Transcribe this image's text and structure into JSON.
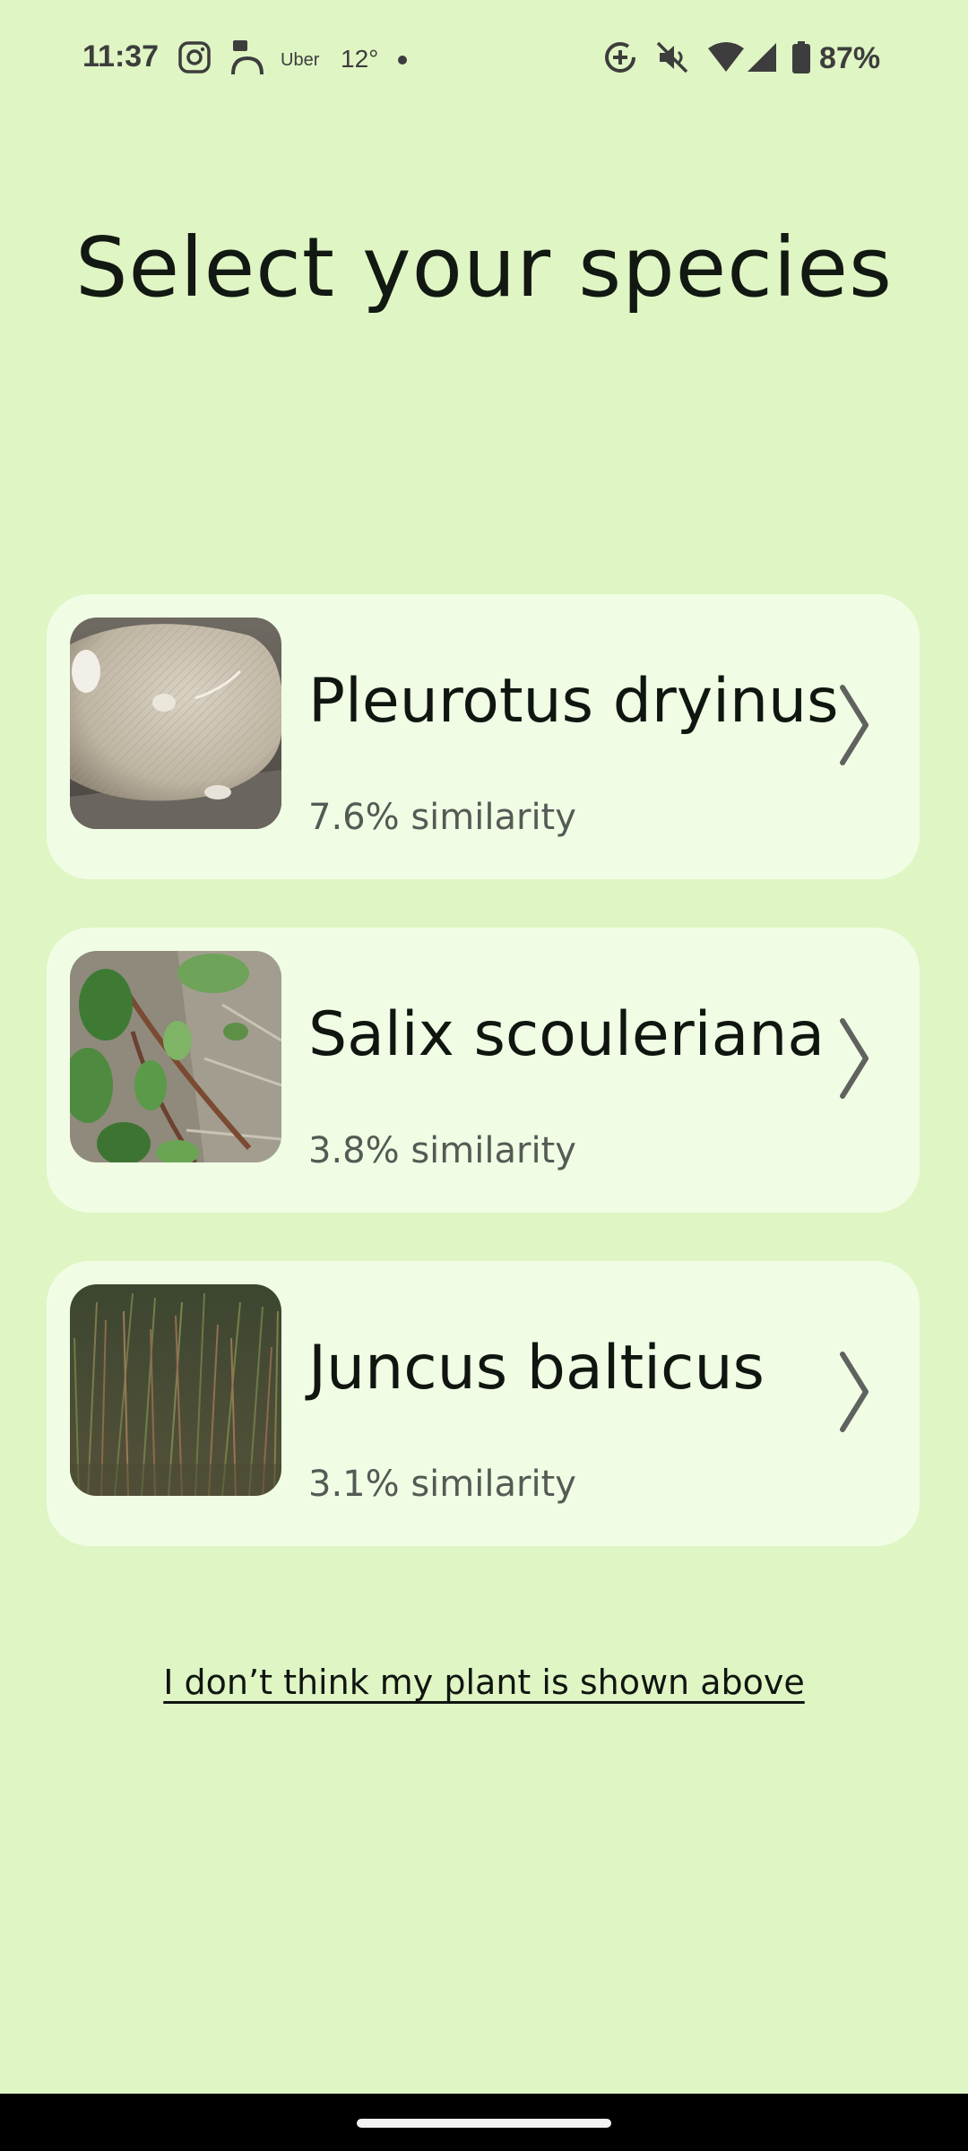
{
  "status_bar": {
    "time": "11:37",
    "notification_icons": [
      "instagram-icon",
      "toll-app-icon",
      "uber-icon"
    ],
    "uber_label": "Uber",
    "temperature": "12°",
    "system_icons": [
      "data-saver-icon",
      "mute-icon",
      "wifi-icon",
      "signal-icon",
      "battery-icon"
    ],
    "battery_percent": "87%"
  },
  "page": {
    "title": "Select your species"
  },
  "species": [
    {
      "name": "Pleurotus dryinus",
      "similarity": "7.6% similarity",
      "image": "mushroom-cap-photo"
    },
    {
      "name": "Salix scouleriana",
      "similarity": "3.8% similarity",
      "image": "willow-leaves-photo"
    },
    {
      "name": "Juncus balticus",
      "similarity": "3.1% similarity",
      "image": "rush-grass-photo"
    }
  ],
  "link": {
    "not_shown_label": "I don’t think my plant is shown above"
  },
  "colors": {
    "background": "#dff5c4",
    "card": "#f0fde4",
    "text": "#101510",
    "secondary_text": "#555a55",
    "chevron": "#5f625f"
  }
}
